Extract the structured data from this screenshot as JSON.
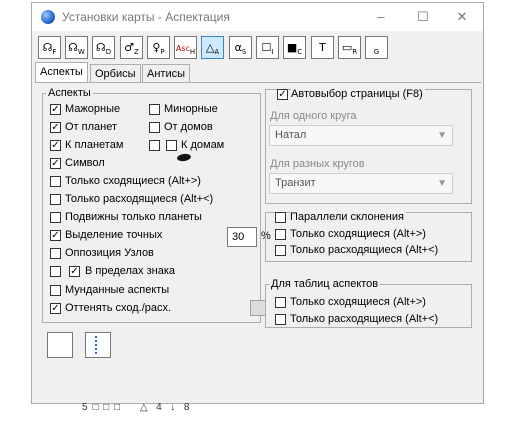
{
  "window": {
    "title": "Установки карты - Аспектация",
    "buttons": {
      "minimize": "–",
      "maximize": "☐",
      "close": "✕"
    }
  },
  "toolbar": [
    {
      "glyph": "☊",
      "sub": "F",
      "name": "toolbar-f-button"
    },
    {
      "glyph": "☊",
      "sub": "W",
      "name": "toolbar-w-button"
    },
    {
      "glyph": "☊",
      "sub": "D",
      "name": "toolbar-d-button"
    },
    {
      "glyph": "♂",
      "sub": "Z",
      "name": "toolbar-z-button"
    },
    {
      "glyph": "♀",
      "sub": "P",
      "name": "toolbar-p-button"
    },
    {
      "glyph": "Asc",
      "sub": "H",
      "name": "toolbar-h-button"
    },
    {
      "glyph": "△",
      "sub": "A",
      "name": "toolbar-a-button",
      "pressed": true
    },
    {
      "glyph": "α",
      "sub": "S",
      "name": "toolbar-s-button"
    },
    {
      "glyph": "☐",
      "sub": "I",
      "name": "toolbar-i-button"
    },
    {
      "glyph": "■",
      "sub": "C",
      "name": "toolbar-c-button"
    },
    {
      "glyph": "T",
      "sub": "",
      "name": "toolbar-t-button"
    },
    {
      "glyph": "▭",
      "sub": "R",
      "name": "toolbar-r-button"
    },
    {
      "glyph": "",
      "sub": "G",
      "name": "toolbar-g-button"
    }
  ],
  "tabs": [
    "Аспекты",
    "Орбисы",
    "Антисы"
  ],
  "aspects_group": {
    "legend": "Аспекты",
    "major": {
      "label": "Мажорные",
      "checked": true
    },
    "minor": {
      "label": "Минорные",
      "checked": false
    },
    "from_planets": {
      "label": "От планет",
      "checked": true
    },
    "from_houses": {
      "label": "От домов",
      "checked": false
    },
    "to_planets": {
      "label": "К планетам",
      "checked": true
    },
    "to_houses": {
      "label": "К домам",
      "checked": false
    },
    "symbol": {
      "label": "Символ",
      "checked": true
    },
    "only_converging": {
      "label": "Только сходящиеся  (Alt+>)",
      "checked": false
    },
    "only_diverging": {
      "label": "Только расходящиеся (Alt+<)",
      "checked": false
    },
    "only_planets_mobile": {
      "label": "Подвижны только планеты",
      "checked": false
    },
    "highlight_exact": {
      "label": "Выделение точных",
      "checked": true
    },
    "precision_value": "30",
    "precision_unit": "%",
    "node_opposition": {
      "label": "Оппозиция Узлов",
      "checked": false
    },
    "within_sign": {
      "label": "В пределах знака",
      "checked": true
    },
    "mundane": {
      "label": "Мунданные аспекты",
      "checked": false
    },
    "shade": {
      "label": "Оттенять сход./расх.",
      "checked": true
    }
  },
  "auto_page": {
    "label": "Автовыбор страницы  (F8)",
    "checked": true
  },
  "single_circle": {
    "label": "Для одного круга",
    "value": "Натал"
  },
  "multi_circle": {
    "label": "Для разных кругов",
    "value": "Транзит"
  },
  "declination_group": {
    "legend": "Параллели склонения",
    "checked": false,
    "only_converging": {
      "label": "Только сходящиеся  (Alt+>)",
      "checked": false
    },
    "only_diverging": {
      "label": "Только расходящиеся (Alt+<)",
      "checked": false
    }
  },
  "tables_group": {
    "legend": "Для таблиц аспектов",
    "only_converging": {
      "label": "Только сходящиеся  (Alt+>)",
      "checked": false
    },
    "only_diverging": {
      "label": "Только расходящиеся (Alt+<)",
      "checked": false
    }
  },
  "under_window_glyphs": "5 □ □ □     △  4  ↓  8",
  "colors": {
    "accent": "#3a86c8",
    "pressed_bg": "#cde8ff",
    "window_bg": "#f0f0f0"
  }
}
